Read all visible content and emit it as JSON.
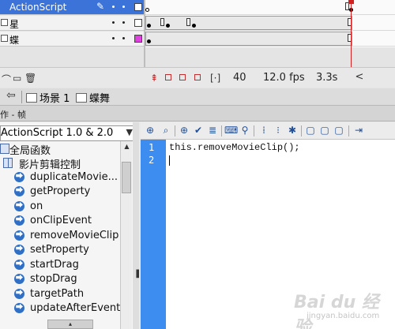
{
  "timeline": {
    "layers": [
      {
        "name": "ActionScript",
        "active": true,
        "color": "#ffffff"
      },
      {
        "name": "星",
        "active": false,
        "color": "#ffffff"
      },
      {
        "name": "蝶",
        "active": false,
        "color": "#e040e0"
      }
    ],
    "current_frame": "40",
    "frame_rate": "12.0 fps",
    "elapsed_time": "3.3s"
  },
  "scene_bar": {
    "scene": "场景 1",
    "symbol": "蝶舞"
  },
  "actions_panel": {
    "title": "作 - 帧",
    "version_dropdown": "ActionScript 1.0 & 2.0",
    "tree": [
      {
        "label": "全局函数",
        "type": "book"
      },
      {
        "label": "影片剪辑控制",
        "type": "book-open"
      },
      {
        "label": "duplicateMovie...",
        "type": "action"
      },
      {
        "label": "getProperty",
        "type": "action"
      },
      {
        "label": "on",
        "type": "action"
      },
      {
        "label": "onClipEvent",
        "type": "action"
      },
      {
        "label": "removeMovieClip",
        "type": "action"
      },
      {
        "label": "setProperty",
        "type": "action"
      },
      {
        "label": "startDrag",
        "type": "action"
      },
      {
        "label": "stopDrag",
        "type": "action"
      },
      {
        "label": "targetPath",
        "type": "action"
      },
      {
        "label": "updateAfterEvent",
        "type": "action"
      }
    ],
    "line_numbers": [
      "1",
      "2"
    ],
    "code_lines": [
      "this.removeMovieClip();",
      ""
    ]
  },
  "watermark": {
    "logo": "Bai du 经验",
    "sub": "jingyan.baidu.com"
  },
  "colors": {
    "active_layer": "#3b73d8",
    "gutter": "#3d8cf0",
    "playhead": "#d02020"
  }
}
